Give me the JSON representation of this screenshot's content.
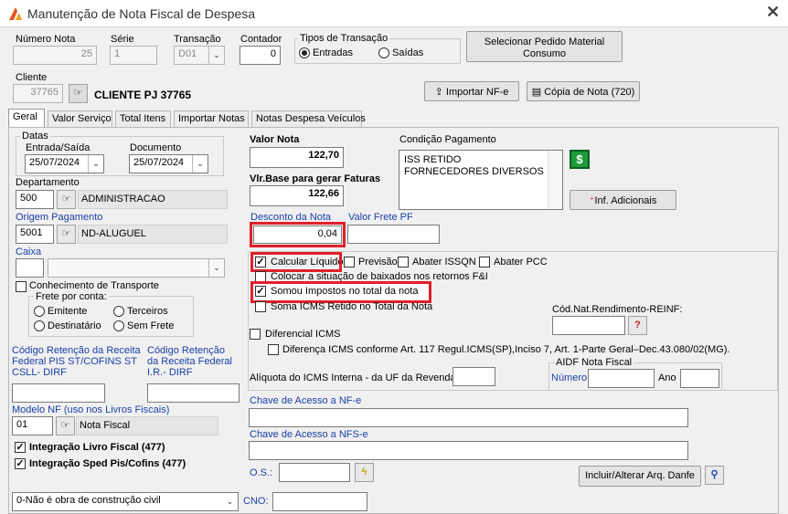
{
  "window": {
    "title": "Manutenção de Nota Fiscal de Despesa",
    "close": "✕"
  },
  "header": {
    "numero_nota": {
      "label": "Número Nota",
      "value": "25"
    },
    "serie": {
      "label": "Série",
      "value": "1"
    },
    "transacao": {
      "label": "Transação",
      "value": "D01"
    },
    "contador": {
      "label": "Contador",
      "value": "0"
    },
    "tipos_transacao": {
      "label": "Tipos de Transação",
      "options": [
        "Entradas",
        "Saídas"
      ],
      "selected": "Entradas"
    },
    "selecionar_pedido_label": "Selecionar Pedido Material Consumo",
    "cliente": {
      "label": "Cliente",
      "code": "37765",
      "name": "CLIENTE PJ 37765"
    },
    "importar_label": "Importar NF-e",
    "copia_label": "Cópia de Nota (720)"
  },
  "tabs": [
    {
      "label": "Geral",
      "active": true
    },
    {
      "label": "Valor Serviço"
    },
    {
      "label": "Total Itens"
    },
    {
      "label": "Importar Notas"
    },
    {
      "label": "Notas Despesa Veículos"
    }
  ],
  "geral": {
    "datas_label": "Datas",
    "entrada_saida": {
      "label": "Entrada/Saída",
      "value": "25/07/2024"
    },
    "documento": {
      "label": "Documento",
      "value": "25/07/2024"
    },
    "departamento": {
      "label": "Departamento",
      "code": "500",
      "name": "ADMINISTRACAO"
    },
    "origem_pagamento": {
      "label": "Origem Pagamento",
      "code": "5001",
      "name": "ND-ALUGUEL"
    },
    "caixa": {
      "label": "Caixa",
      "code": "",
      "value": ""
    },
    "conhecimento_transporte": {
      "label": "Conhecimento de Transporte",
      "checked": false
    },
    "frete_por_conta": {
      "label": "Frete por conta:",
      "options": [
        "Emitente",
        "Terceiros",
        "Destinatário",
        "Sem Frete"
      ]
    },
    "cod_retencao_pis": {
      "label_lines": [
        "Código Retenção da Receita",
        "Federal PIS ST/COFINS ST",
        "CSLL- DIRF"
      ],
      "value": ""
    },
    "cod_retencao_ir": {
      "label_lines": [
        "Código Retenção",
        "da Receita Federal",
        "I.R.- DIRF"
      ],
      "value": ""
    },
    "modelo_nf": {
      "label": "Modelo NF (uso nos Livros Fiscais)",
      "code": "01",
      "name": "Nota Fiscal"
    },
    "integracao_livro_fiscal": {
      "label": "Integração Livro Fiscal (477)",
      "checked": true
    },
    "integracao_sped": {
      "label": "Integração Sped Pis/Cofins (477)",
      "checked": true
    },
    "obra_construcao": {
      "value": "0-Não é obra de construção civil"
    },
    "cno": {
      "label": "CNO:",
      "value": ""
    },
    "valor_nota": {
      "label": "Valor Nota",
      "value": "122,70"
    },
    "vlr_base": {
      "label": "Vlr.Base para gerar Faturas",
      "value": "122,66"
    },
    "condicao_pagamento": {
      "label": "Condição Pagamento",
      "lines": [
        "ISS RETIDO",
        "FORNECEDORES DIVERSOS"
      ]
    },
    "dollar_icon_label": "$",
    "inf_adicionais_label": "Inf. Adicionais",
    "desconto_nota": {
      "label": "Desconto da Nota",
      "value": "0,04"
    },
    "valor_frete_pf": {
      "label": "Valor Frete PF",
      "value": ""
    },
    "calcular_liquido": {
      "label": "Calcular Líquido",
      "checked": true
    },
    "previsao": {
      "label": "Previsão",
      "checked": false
    },
    "abater_issqn": {
      "label": "Abater ISSQN",
      "checked": false
    },
    "abater_pcc": {
      "label": "Abater PCC",
      "checked": false
    },
    "colocar_situacao": {
      "label": "Colocar a situação de baixados nos retornos F&I",
      "checked": false
    },
    "somou_impostos": {
      "label": "Somou Impostos no total da nota",
      "checked": true
    },
    "soma_icms_retido": {
      "label": "Soma ICMS Retido no Total da Nota",
      "checked": false
    },
    "diferencial_icms": {
      "label": "Diferencial ICMS",
      "checked": false
    },
    "diferenca_icms": {
      "label": "Diferença ICMS conforme Art. 117 Regul.ICMS(SP),Inciso 7, Art. 1-Parte Geral–Dec.43.080/02(MG).",
      "checked": false
    },
    "cod_nat_rendimento": {
      "label": "Cód.Nat.Rendimento-REINF:",
      "value": ""
    },
    "aliquota_icms": {
      "label": "Alíquota do ICMS Interna - da UF da Revenda",
      "value": ""
    },
    "aidf": {
      "label": "AIDF Nota Fiscal",
      "numero_label": "Número",
      "ano_label": "Ano",
      "numero": "",
      "ano": ""
    },
    "chave_nfe": {
      "label": "Chave de Acesso a NF-e",
      "value": ""
    },
    "chave_nfse": {
      "label": "Chave de Acesso a NFS-e",
      "value": ""
    },
    "os": {
      "label": "O.S.:",
      "value": ""
    },
    "incluir_danfe_label": "Incluir/Alterar Arq. Danfe"
  }
}
